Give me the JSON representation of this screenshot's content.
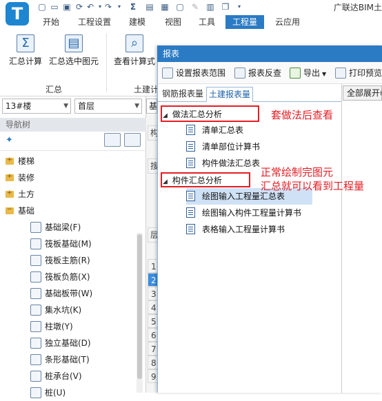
{
  "app_title": "广联达BIM土",
  "menu_tabs": [
    "开始",
    "工程设置",
    "建模",
    "视图",
    "工具",
    "工程量",
    "云应用"
  ],
  "ribbon": {
    "buttons": [
      "汇总计算",
      "汇总选中图元",
      "查看计算式"
    ],
    "group_label": "汇总",
    "group_label_2": "土建计"
  },
  "left": {
    "floor_combo": "13#楼",
    "layer_combo": "首层",
    "combo3": "基",
    "nav_header": "导航树",
    "folders": [
      "楼梯",
      "装修",
      "土方",
      "基础"
    ],
    "sub_items": [
      "基础梁(F)",
      "筏板基础(M)",
      "筏板主筋(R)",
      "筏板负筋(X)",
      "基础板带(W)",
      "集水坑(K)",
      "柱墩(Y)",
      "独立基础(D)",
      "条形基础(T)",
      "桩承台(V)",
      "桩(U)"
    ]
  },
  "middle": {
    "cells": [
      "构",
      "搜",
      "层",
      "1",
      "2",
      "3",
      "4",
      "5",
      "6",
      "7",
      "8",
      "9"
    ]
  },
  "report": {
    "title": "报表",
    "toolbar": [
      "设置报表范围",
      "报表反查",
      "导出",
      "打印预览"
    ],
    "tabs": [
      "钢筋报表量",
      "土建报表量"
    ],
    "expand_all": "全部展开(",
    "tree": [
      {
        "label": "做法汇总分析",
        "items": [
          "清单汇总表",
          "清单部位计算书",
          "构件做法汇总表"
        ]
      },
      {
        "label": "构件汇总分析",
        "items": [
          "绘图输入工程量汇总表",
          "绘图输入构件工程量计算书",
          "表格输入工程量计算书"
        ]
      }
    ]
  },
  "annotations": {
    "a1": "套做法后查看",
    "a2_line1": "正常绘制完图元",
    "a2_line2": "汇总就可以看到工程量"
  },
  "colors": {
    "accent": "#2b7bc4",
    "annotation": "#e51c23",
    "selected_row": "#cfe1f5"
  }
}
